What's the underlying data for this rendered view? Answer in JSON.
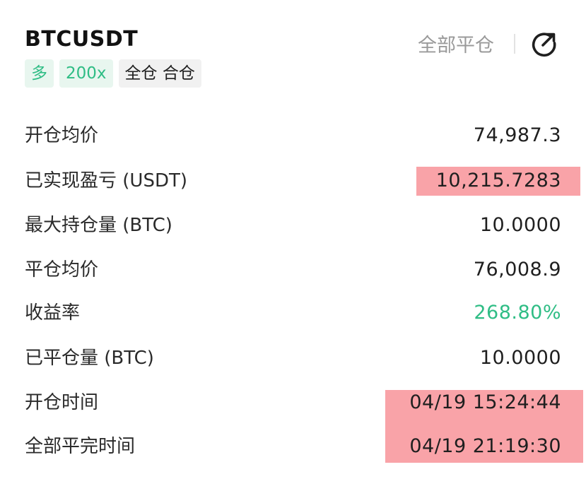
{
  "header": {
    "symbol": "BTCUSDT",
    "close_all_label": "全部平仓",
    "share_icon": "share-arrow-icon"
  },
  "tags": {
    "side": "多",
    "leverage": "200x",
    "margin_mode": "全仓 合仓"
  },
  "details": {
    "avg_open_price": {
      "label": "开仓均价",
      "value": "74,987.3"
    },
    "realized_pnl": {
      "label": "已实现盈亏 (USDT)",
      "value": "10,215.7283"
    },
    "max_position": {
      "label": "最大持仓量 (BTC)",
      "value": "10.0000"
    },
    "avg_close_price": {
      "label": "平仓均价",
      "value": "76,008.9"
    },
    "roi": {
      "label": "收益率",
      "value": "268.80%"
    },
    "closed_amount": {
      "label": "已平仓量 (BTC)",
      "value": "10.0000"
    },
    "open_time": {
      "label": "开仓时间",
      "value": "04/19 15:24:44"
    },
    "full_close_time": {
      "label": "全部平完时间",
      "value": "04/19 21:19:30"
    }
  },
  "colors": {
    "positive": "#2fbd85",
    "highlight": "#f9a3a8"
  }
}
